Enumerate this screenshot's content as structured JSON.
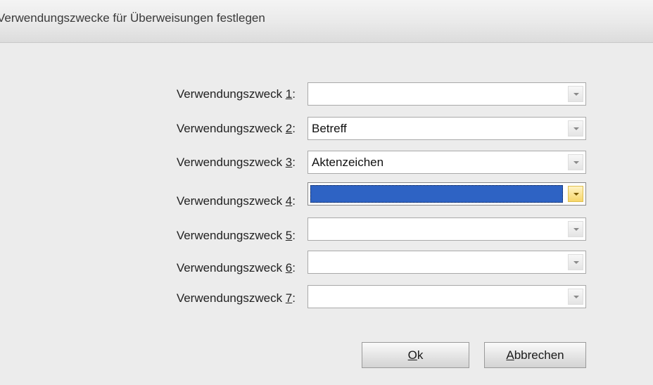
{
  "window": {
    "title": "Verwendungszwecke für Überweisungen festlegen"
  },
  "fields": [
    {
      "label_prefix": "Verwendungszweck ",
      "label_key": "1",
      "label_suffix": ":",
      "value": ""
    },
    {
      "label_prefix": "Verwendungszweck ",
      "label_key": "2",
      "label_suffix": ":",
      "value": "Betreff"
    },
    {
      "label_prefix": "Verwendungszweck ",
      "label_key": "3",
      "label_suffix": ":",
      "value": "Aktenzeichen"
    },
    {
      "label_prefix": "Verwendungszweck ",
      "label_key": "4",
      "label_suffix": ":",
      "value": "",
      "focused": true
    },
    {
      "label_prefix": "Verwendungszweck ",
      "label_key": "5",
      "label_suffix": ":",
      "value": ""
    },
    {
      "label_prefix": "Verwendungszweck ",
      "label_key": "6",
      "label_suffix": ":",
      "value": ""
    },
    {
      "label_prefix": "Verwendungszweck ",
      "label_key": "7",
      "label_suffix": ":",
      "value": ""
    }
  ],
  "buttons": {
    "ok": {
      "key": "O",
      "rest": "k"
    },
    "cancel": {
      "key": "A",
      "rest": "bbrechen"
    }
  },
  "icons": {
    "dropdown": "chevron-down-icon"
  },
  "colors": {
    "selection": "#2e63c4",
    "focused_arrow": "#f7d66a"
  }
}
